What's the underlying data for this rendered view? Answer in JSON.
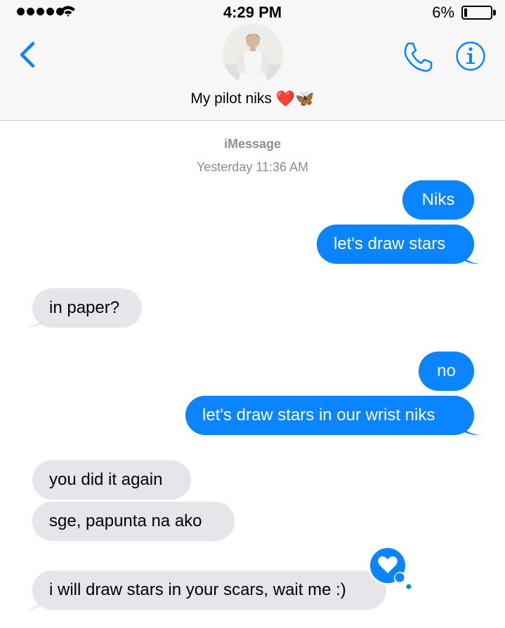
{
  "status_bar": {
    "time": "4:29 PM",
    "battery": "6%"
  },
  "header": {
    "contact_name": "My pilot niks",
    "emoji": "❤️🦋"
  },
  "thread": {
    "service": "iMessage",
    "timestamp": "Yesterday 11:36 AM",
    "messages": [
      {
        "from": "me",
        "text": "Niks"
      },
      {
        "from": "me",
        "text": "let's draw stars"
      },
      {
        "from": "them",
        "text": "in paper?"
      },
      {
        "from": "me",
        "text": "no"
      },
      {
        "from": "me",
        "text": "let's draw stars in our wrist niks"
      },
      {
        "from": "them",
        "text": "you did it again"
      },
      {
        "from": "them",
        "text": "sge, papunta na ako"
      },
      {
        "from": "them",
        "text": "i will draw stars in your scars, wait me :)",
        "reaction": "heart"
      }
    ]
  },
  "colors": {
    "accent": "#0a84ff",
    "incoming": "#e5e5ea",
    "header_bg": "#f7f7f7"
  }
}
